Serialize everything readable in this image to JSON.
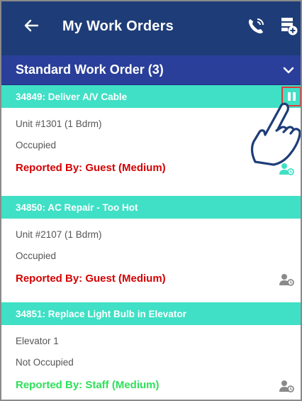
{
  "appbar": {
    "back_icon": "arrow-left-icon",
    "title": "My Work Orders",
    "call_icon": "phone-call-icon",
    "add_icon": "add-list-icon"
  },
  "section": {
    "title": "Standard Work Order (3)",
    "chevron_icon": "chevron-down-icon"
  },
  "work_orders": [
    {
      "title": "34849: Deliver A/V Cable",
      "unit": "Unit #1301 (1 Bdrm)",
      "occupancy": "Occupied",
      "reported": "Reported By: Guest  (Medium)",
      "reported_color": "#d50000",
      "assign_icon_color": "#3fe0c5",
      "has_pause": true
    },
    {
      "title": "34850: AC Repair - Too Hot",
      "unit": "Unit #2107 (1 Bdrm)",
      "occupancy": "Occupied",
      "reported": "Reported By: Guest  (Medium)",
      "reported_color": "#d50000",
      "assign_icon_color": "#8a8a8a",
      "has_pause": false
    },
    {
      "title": "34851: Replace Light Bulb in Elevator",
      "unit": "Elevator 1",
      "occupancy": "Not Occupied",
      "reported": "Reported By: Staff  (Medium)",
      "reported_color": "#2ee05a",
      "assign_icon_color": "#8a8a8a",
      "has_pause": false
    }
  ],
  "colors": {
    "appbar": "#1e3d78",
    "section": "#2a3f9a",
    "card_header": "#3fe0c5",
    "highlight": "#e53935"
  }
}
